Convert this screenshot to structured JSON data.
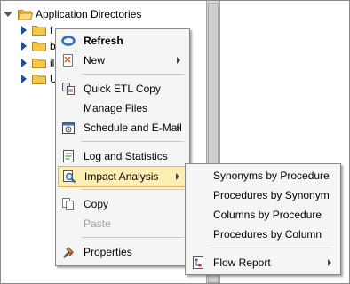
{
  "tree": {
    "root_label": "Application Directories",
    "children": [
      {
        "label_visible": "f"
      },
      {
        "label_visible": "b"
      },
      {
        "label_visible": "il"
      },
      {
        "label_visible": "U"
      }
    ]
  },
  "context_menu": {
    "items": [
      {
        "label": "Refresh",
        "icon": "refresh-icon"
      },
      {
        "label": "New",
        "icon": "new-icon"
      },
      {
        "label": "Quick ETL Copy",
        "icon": "etl-copy-icon"
      },
      {
        "label": "Manage Files"
      },
      {
        "label": "Schedule and E-Mail",
        "icon": "schedule-icon"
      },
      {
        "label": "Log and Statistics",
        "icon": "log-statistics-icon"
      },
      {
        "label": "Impact Analysis",
        "icon": "impact-analysis-icon"
      },
      {
        "label": "Copy",
        "icon": "copy-icon"
      },
      {
        "label": "Paste"
      },
      {
        "label": "Properties",
        "icon": "properties-icon"
      }
    ]
  },
  "submenu": {
    "items": [
      {
        "label": "Synonyms by Procedure"
      },
      {
        "label": "Procedures by Synonym"
      },
      {
        "label": "Columns by Procedure"
      },
      {
        "label": "Procedures by Column"
      },
      {
        "label": "Flow Report",
        "icon": "flow-report-icon"
      }
    ]
  },
  "colors": {
    "highlight_bg": "#ffeeb3",
    "highlight_border": "#e9b84a",
    "folder": "#f4c64a",
    "expander": "#1e4f9c"
  }
}
